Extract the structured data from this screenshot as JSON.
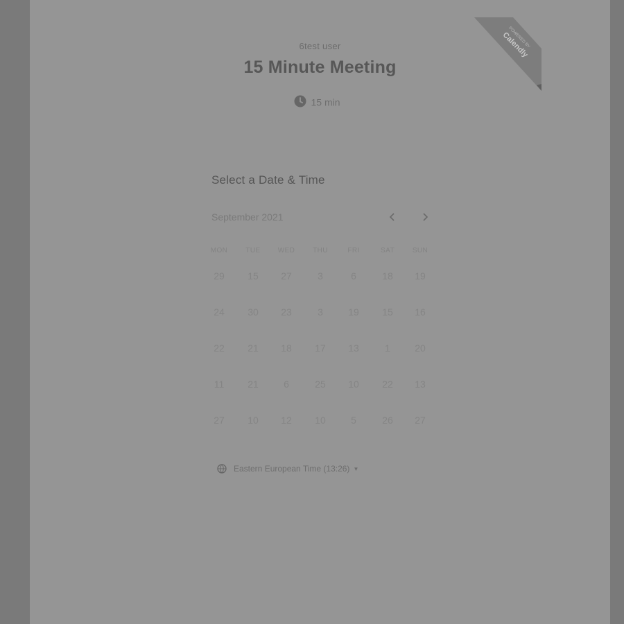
{
  "host": {
    "name": "6test user"
  },
  "event": {
    "title": "15 Minute Meeting",
    "duration": "15 min"
  },
  "branding": {
    "ribbon_top": "POWERED BY",
    "ribbon_brand": "Calendly"
  },
  "calendar": {
    "section_title": "Select a Date & Time",
    "month_label": "September 2021",
    "prev_icon": "chevron-left-icon",
    "next_icon": "chevron-right-icon",
    "weekdays": [
      "MON",
      "TUE",
      "WED",
      "THU",
      "FRI",
      "SAT",
      "SUN"
    ],
    "weeks": [
      [
        "29",
        "15",
        "27",
        "3",
        "6",
        "18",
        "19"
      ],
      [
        "24",
        "30",
        "23",
        "3",
        "19",
        "15",
        "16"
      ],
      [
        "22",
        "21",
        "18",
        "17",
        "13",
        "1",
        "20"
      ],
      [
        "11",
        "21",
        "6",
        "25",
        "10",
        "22",
        "13"
      ],
      [
        "27",
        "10",
        "12",
        "10",
        "5",
        "26",
        "27"
      ]
    ]
  },
  "timezone": {
    "label": "Eastern European Time (13:26)",
    "icon": "globe-icon"
  },
  "colors": {
    "overlay_bg": "#7a7a7a",
    "panel_bg": "#959595",
    "ribbon": "#7d7d7d"
  }
}
